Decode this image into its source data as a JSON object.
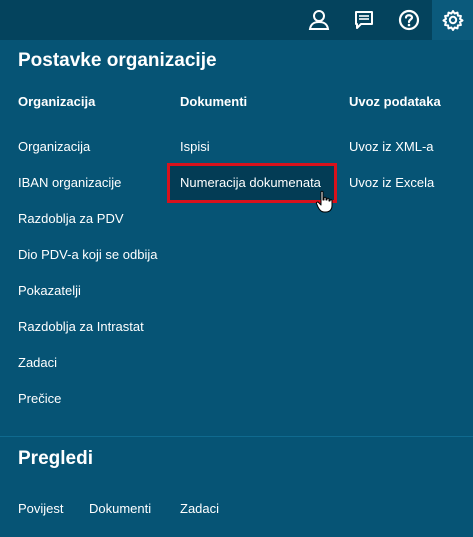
{
  "topbar": {
    "icons": [
      "user-icon",
      "messages-icon",
      "help-icon",
      "settings-icon"
    ]
  },
  "settings": {
    "title": "Postavke organizacije",
    "columns": {
      "organizacija": {
        "heading": "Organizacija",
        "items": [
          "Organizacija",
          "IBAN organizacije",
          "Razdoblja za PDV",
          "Dio PDV-a koji se odbija",
          "Pokazatelji",
          "Razdoblja za Intrastat",
          "Zadaci",
          "Prečice"
        ]
      },
      "dokumenti": {
        "heading": "Dokumenti",
        "items": [
          "Ispisi",
          "Numeracija dokumenata"
        ]
      },
      "uvoz": {
        "heading": "Uvoz podataka",
        "items": [
          "Uvoz iz XML-a",
          "Uvoz iz Excela"
        ]
      }
    }
  },
  "pregledi": {
    "title": "Pregledi",
    "items": [
      "Povijest",
      "Dokumenti",
      "Zadaci"
    ]
  },
  "colors": {
    "topbar": "#04435d",
    "panel": "#065475",
    "highlight_border": "#d8121c",
    "highlight_fill": "#033c55"
  }
}
